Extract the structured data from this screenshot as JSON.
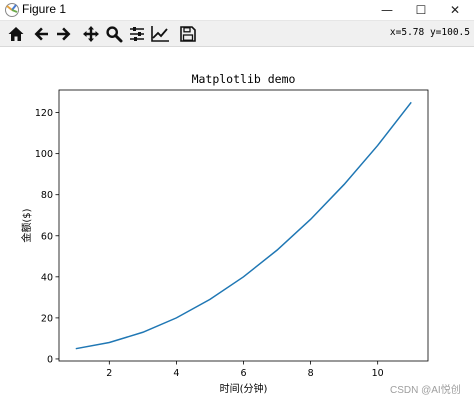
{
  "window": {
    "title": "Figure 1",
    "minimize_glyph": "—",
    "maximize_glyph": "☐",
    "close_glyph": "✕"
  },
  "toolbar": {
    "icons": [
      "home-icon",
      "back-arrow-icon",
      "forward-arrow-icon",
      "pan-move-icon",
      "zoom-icon",
      "configure-subplots-icon",
      "edit-axis-icon",
      "save-icon"
    ],
    "coords_text": "x=5.78 y=100.5"
  },
  "chart_data": {
    "type": "line",
    "title": "Matplotlib demo",
    "xlabel": "时间(分钟)",
    "ylabel": "金额($)",
    "xlim": [
      0.5,
      11.5
    ],
    "ylim": [
      -1,
      131
    ],
    "x_ticks": [
      2,
      4,
      6,
      8,
      10
    ],
    "y_ticks": [
      0,
      20,
      40,
      60,
      80,
      100,
      120
    ],
    "series": [
      {
        "color": "#1f77b4",
        "x": [
          1,
          2,
          3,
          4,
          5,
          6,
          7,
          8,
          9,
          10,
          11
        ],
        "y": [
          5,
          8,
          13,
          20,
          29,
          40,
          53,
          68,
          85,
          104,
          125
        ]
      }
    ]
  },
  "watermark": "CSDN @AI悦创"
}
